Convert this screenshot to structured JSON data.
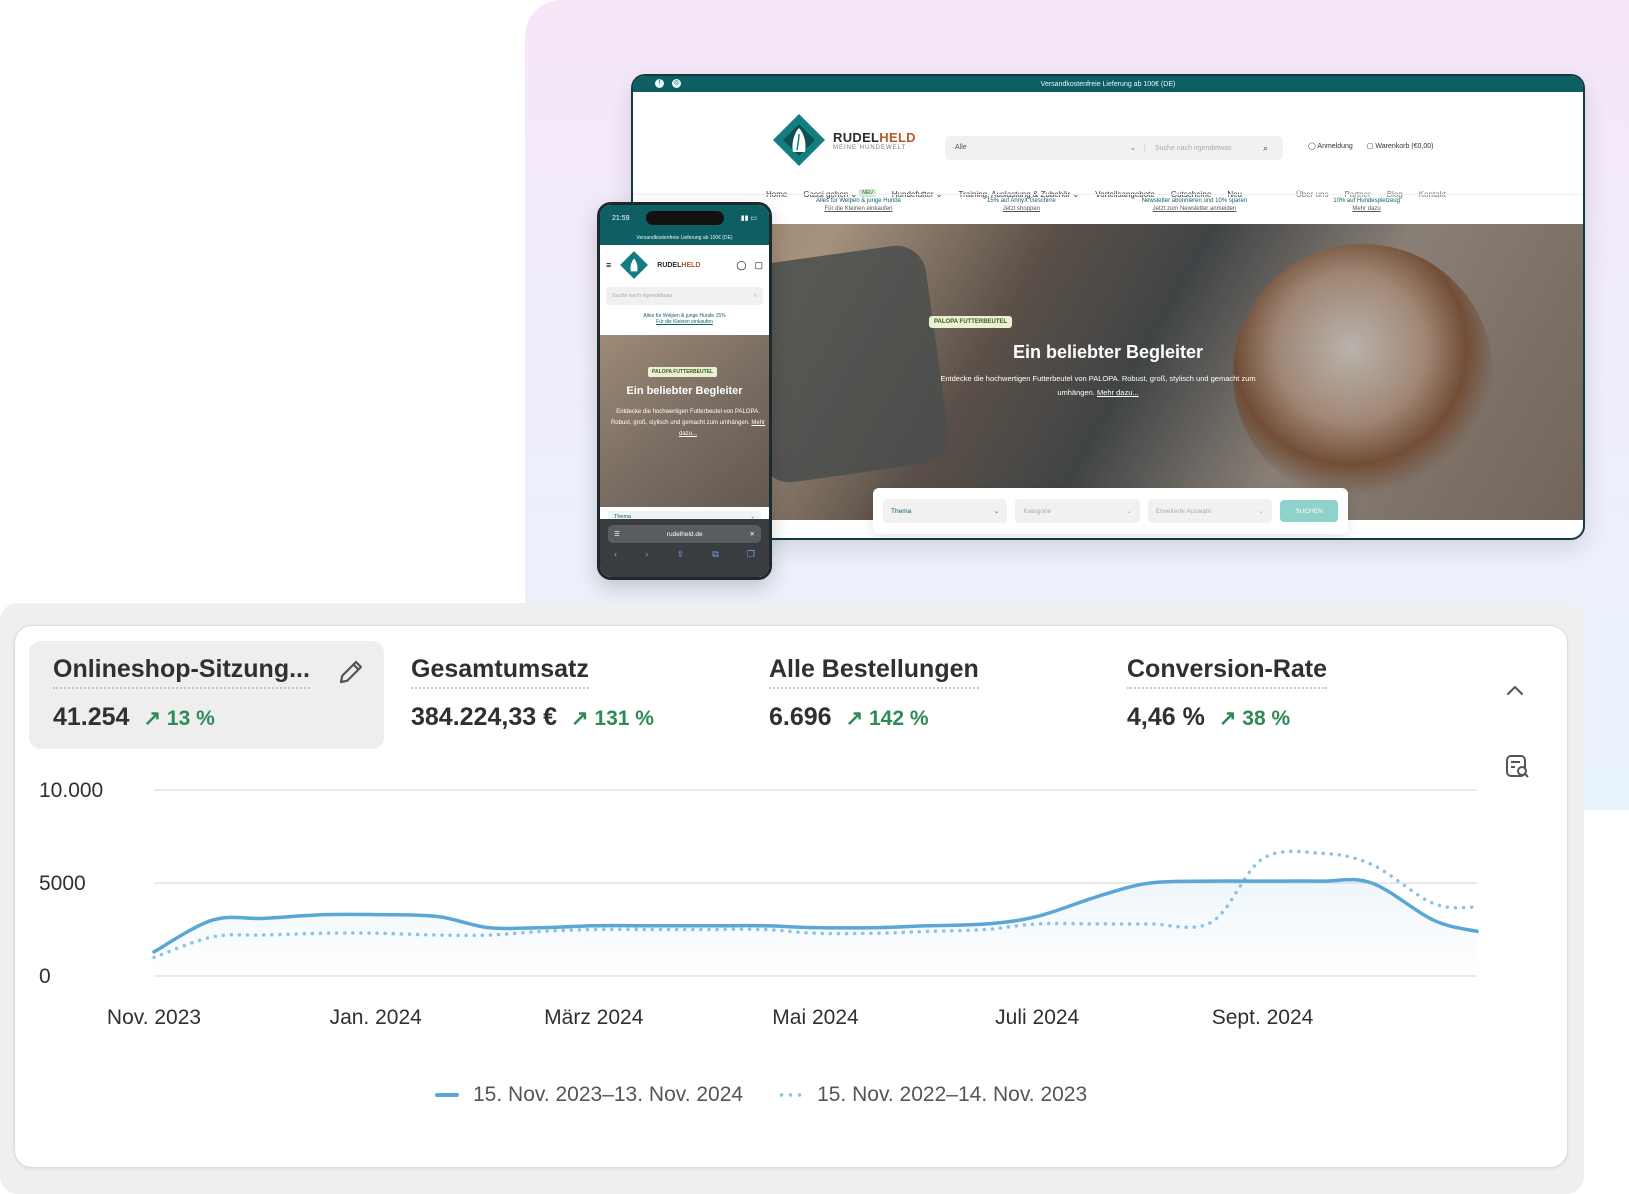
{
  "desktop": {
    "shipping_banner": "Versandkostenfreie Lieferung ab 100€ (DE)",
    "brand": "RUDEL",
    "brand_accent": "HELD",
    "brand_sub": "MEINE HUNDEWELT",
    "search_category": "Alle",
    "search_placeholder": "Suche nach irgendetwas",
    "account_label": "Anmeldung",
    "cart_label": "Warenkorb (€0,00)",
    "nav": [
      "Home",
      "Gassi gehen",
      "Hundefutter",
      "Training, Auslastung & Zubehör",
      "Vorteilsangebote",
      "Gutscheine",
      "Neu"
    ],
    "nav_new_badge": "NEU",
    "nav_secondary": [
      "Über uns",
      "Partner",
      "Blog",
      "Kontakt"
    ],
    "promos": [
      {
        "title": "Alles für Welpen & junge Hunde",
        "link": "Für die Kleinen einkaufen"
      },
      {
        "title": "15% auf AnnyX Geschirre",
        "link": "Jetzt shoppen"
      },
      {
        "title": "Newsletter abonnieren und 10% sparen",
        "link": "Jetzt zum Newsletter anmelden"
      },
      {
        "title": "10% auf Hundespielzeug",
        "link": "Mehr dazu"
      }
    ],
    "hero_badge": "PALOPA FUTTERBEUTEL",
    "hero_title": "Ein beliebter Begleiter",
    "hero_text": "Entdecke die hochwertigen Futterbeutel von PALOPA. Robust, groß, stylisch und gemacht zum umhängen.",
    "hero_link": "Mehr dazu...",
    "filter_thema": "Thema",
    "filter_kategorie": "Kategorie",
    "filter_erweitert": "Erweiterte Auswahl",
    "filter_button": "SUCHEN"
  },
  "phone": {
    "time": "21:59",
    "shipping_banner": "Versandkostenfreie Lieferung ab 100€ (DE)",
    "search_placeholder": "Suche nach irgendetwas",
    "promo_title": "Alles für Welpen & junge Hunde",
    "promo_link": "Für die Kleinen einkaufen",
    "promo_side": "15%",
    "hero_badge": "PALOPA FUTTERBEUTEL",
    "hero_title": "Ein beliebter Begleiter",
    "hero_text": "Entdecke die hochwertigen Futterbeutel von PALOPA. Robust, groß, stylisch und gemacht zum umhängen.",
    "hero_link": "Mehr dazu...",
    "filter_thema": "Thema",
    "url": "rudelheld.de"
  },
  "metrics": [
    {
      "title": "Onlineshop-Sitzung...",
      "value": "41.254",
      "delta": "13 %"
    },
    {
      "title": "Gesamtumsatz",
      "value": "384.224,33 €",
      "delta": "131 %"
    },
    {
      "title": "Alle Bestellungen",
      "value": "6.696",
      "delta": "142 %"
    },
    {
      "title": "Conversion-Rate",
      "value": "4,46 %",
      "delta": "38 %"
    }
  ],
  "colors": {
    "current_series": "#5aa6d6",
    "previous_series": "#8cc3e4",
    "delta_up": "#2e8a57",
    "brand_teal": "#0e5f63"
  },
  "chart_data": {
    "type": "line",
    "ylim": [
      0,
      10000
    ],
    "yticks": [
      "0",
      "5000",
      "10.000"
    ],
    "xticks": [
      "Nov. 2023",
      "Jan. 2024",
      "März 2024",
      "Mai 2024",
      "Juli 2024",
      "Sept. 2024"
    ],
    "x": [
      "2023-11-15",
      "2023-12-01",
      "2023-12-15",
      "2024-01-01",
      "2024-01-15",
      "2024-02-01",
      "2024-02-15",
      "2024-03-01",
      "2024-03-15",
      "2024-04-01",
      "2024-04-15",
      "2024-05-01",
      "2024-05-15",
      "2024-06-01",
      "2024-06-15",
      "2024-07-01",
      "2024-07-15",
      "2024-08-01",
      "2024-08-15",
      "2024-09-01",
      "2024-09-15",
      "2024-10-01",
      "2024-10-15",
      "2024-11-01",
      "2024-11-13"
    ],
    "series": [
      {
        "name": "15. Nov. 2023–13. Nov. 2024",
        "style": "solid",
        "values": [
          1300,
          3000,
          3100,
          3300,
          3300,
          3200,
          2600,
          2600,
          2700,
          2700,
          2700,
          2700,
          2600,
          2600,
          2700,
          2800,
          3200,
          4300,
          5000,
          5100,
          5100,
          5100,
          5000,
          3000,
          2400
        ]
      },
      {
        "name": "15. Nov. 2022–14. Nov. 2023",
        "style": "dotted",
        "values": [
          1000,
          2100,
          2200,
          2300,
          2300,
          2200,
          2200,
          2400,
          2500,
          2500,
          2500,
          2500,
          2300,
          2300,
          2400,
          2500,
          2800,
          2800,
          2800,
          2900,
          6300,
          6600,
          6000,
          3900,
          3700
        ]
      }
    ]
  }
}
